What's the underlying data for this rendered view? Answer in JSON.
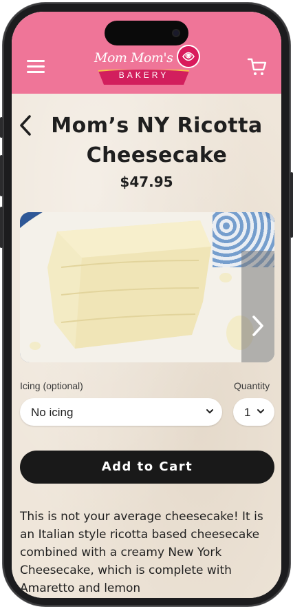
{
  "header": {
    "logo_script": "Mom Mom's",
    "logo_subtitle": "BAKERY",
    "colors": {
      "header_bg": "#ef7598",
      "rose": "#d91a5c",
      "banner": "#d21f5d"
    },
    "icons": [
      "hamburger-menu-icon",
      "cart-icon"
    ]
  },
  "product": {
    "title": "Mom’s NY Ricotta Cheesecake",
    "price": "$47.95"
  },
  "options": {
    "icing_label": "Icing (optional)",
    "icing_value": "No icing",
    "quantity_label": "Quantity",
    "quantity_value": "1"
  },
  "actions": {
    "add_to_cart": "Add to Cart"
  },
  "description": "This is not your average cheesecake! It is an Italian style ricotta based cheesecake combined with a creamy New York Cheesecake, which is complete with Amaretto and lemon"
}
